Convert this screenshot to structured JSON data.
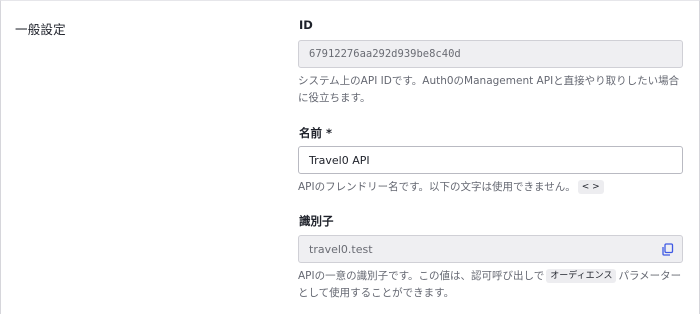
{
  "section": {
    "title": "一般設定"
  },
  "id_field": {
    "label": "ID",
    "value": "67912276aa292d939be8c40d",
    "help": "システム上のAPI IDです。Auth0のManagement APIと直接やり取りしたい場合に役立ちます。"
  },
  "name_field": {
    "label": "名前 *",
    "value": "Travel0 API",
    "help_prefix": "APIのフレンドリー名です。以下の文字は使用できません。",
    "forbidden_chars": "< >"
  },
  "identifier_field": {
    "label": "識別子",
    "value": "travel0.test",
    "help_prefix": "APIの一意の識別子です。この値は、認可呼び出しで",
    "help_chip": "オーディエンス",
    "help_suffix": "パラメーターとして使用することができます。"
  },
  "icons": {
    "copy": "copy-icon"
  },
  "colors": {
    "accent": "#3f59e4",
    "readonly_bg": "#efeff2",
    "border": "#d0d0d6"
  }
}
